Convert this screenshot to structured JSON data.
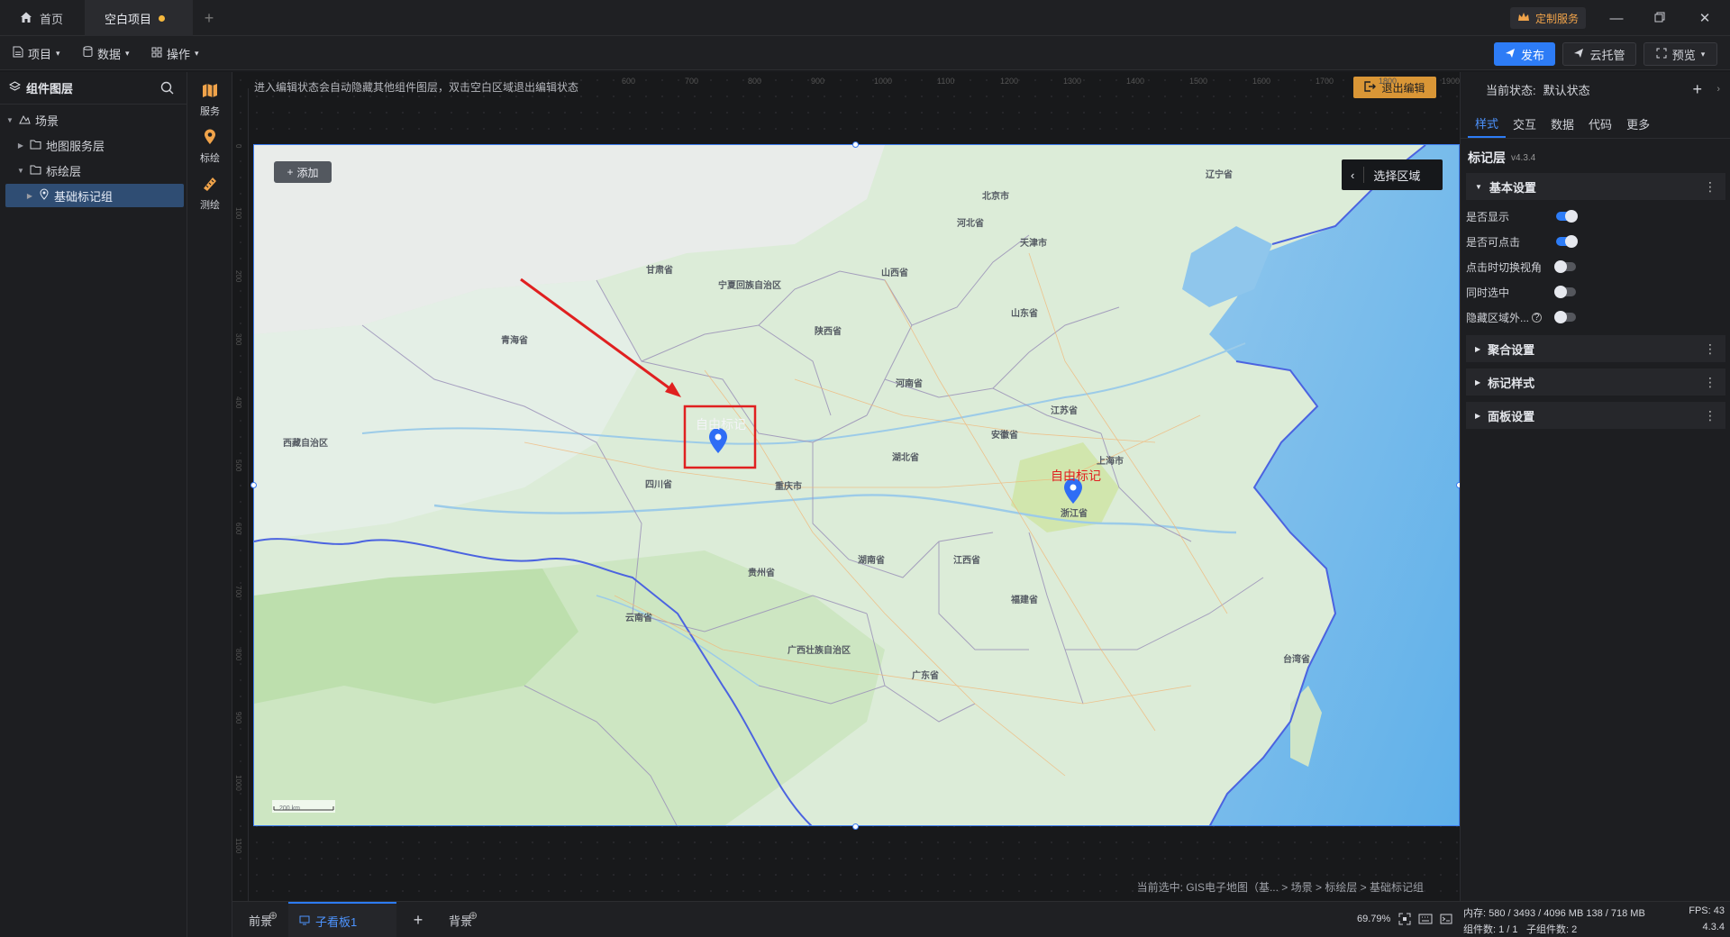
{
  "titlebar": {
    "tabs": [
      {
        "label": "首页",
        "icon": "home-icon"
      },
      {
        "label": "空白项目",
        "icon": "unsaved-dot"
      }
    ],
    "custom_service": "定制服务"
  },
  "menubar": {
    "menus": [
      {
        "label": "项目",
        "icon": "file-icon"
      },
      {
        "label": "数据",
        "icon": "database-icon"
      },
      {
        "label": "操作",
        "icon": "grid-icon"
      }
    ],
    "publish": "发布",
    "cloud_host": "云托管",
    "preview": "预览"
  },
  "layers": {
    "title": "组件图层",
    "items": [
      {
        "label": "场景",
        "level": 0,
        "expanded": true
      },
      {
        "label": "地图服务层",
        "level": 1,
        "expanded": false
      },
      {
        "label": "标绘层",
        "level": 1,
        "expanded": true
      },
      {
        "label": "基础标记组",
        "level": 2,
        "expanded": false,
        "selected": true
      }
    ]
  },
  "tools": [
    {
      "label": "服务",
      "icon": "map-service-icon"
    },
    {
      "label": "标绘",
      "icon": "pin-icon"
    },
    {
      "label": "测绘",
      "icon": "measure-icon"
    }
  ],
  "canvas": {
    "hint": "进入编辑状态会自动隐藏其他组件图层，双击空白区域退出编辑状态",
    "exit_edit": "退出编辑",
    "add": "添加",
    "select_region": "选择区域",
    "marker_1": "自由标记",
    "marker_2": "自由标记",
    "scale": "200 km",
    "ruler_top": [
      "600",
      "700",
      "800",
      "900",
      "1000",
      "1100",
      "1200",
      "1300",
      "1400",
      "1500",
      "1600",
      "1700",
      "1800",
      "1900"
    ],
    "ruler_left": [
      "0",
      "100",
      "200",
      "300",
      "400",
      "500",
      "600",
      "700",
      "800",
      "900",
      "1000",
      "1100"
    ],
    "provinces": [
      "甘肃省",
      "宁夏回族自治区",
      "山西省",
      "河北省",
      "北京市",
      "天津市",
      "青海省",
      "陕西省",
      "山东省",
      "河南省",
      "江苏省",
      "安徽省",
      "上海市",
      "湖北省",
      "四川省",
      "重庆市",
      "西藏自治区",
      "浙江省",
      "湖南省",
      "江西省",
      "贵州省",
      "云南省",
      "福建省",
      "广西壮族自治区",
      "广东省",
      "台湾省",
      "辽宁省"
    ],
    "status_path": "当前选中: GIS电子地图（基... > 场景 > 标绘层 > 基础标记组"
  },
  "bottom": {
    "front": "前景",
    "subboard": "子看板1",
    "background": "背景",
    "zoom": "69.79%"
  },
  "inspector": {
    "state_label": "当前状态:",
    "state_value": "默认状态",
    "tabs": [
      "样式",
      "交互",
      "数据",
      "代码",
      "更多"
    ],
    "active_tab": "样式",
    "layer_name": "标记层",
    "version": "v4.3.4",
    "sections": [
      {
        "label": "基本设置",
        "expanded": true
      },
      {
        "label": "聚合设置",
        "expanded": false
      },
      {
        "label": "标记样式",
        "expanded": false
      },
      {
        "label": "面板设置",
        "expanded": false
      }
    ],
    "props": [
      {
        "label": "是否显示",
        "on": true
      },
      {
        "label": "是否可点击",
        "on": true
      },
      {
        "label": "点击时切换视角",
        "on": false
      },
      {
        "label": "同时选中",
        "on": false
      },
      {
        "label": "隐藏区域外...",
        "on": false
      }
    ]
  },
  "status": {
    "memory": "内存: 580 / 3493 / 4096 MB  138 / 718 MB",
    "fps": "FPS: 43",
    "components": "组件数: 1 / 1",
    "sub_components": "子组件数: 2",
    "version": "4.3.4"
  },
  "colors": {
    "accent": "#2d7cf6",
    "exit": "#d99636",
    "marker": "#2f6df5",
    "arrow": "#e02020"
  }
}
